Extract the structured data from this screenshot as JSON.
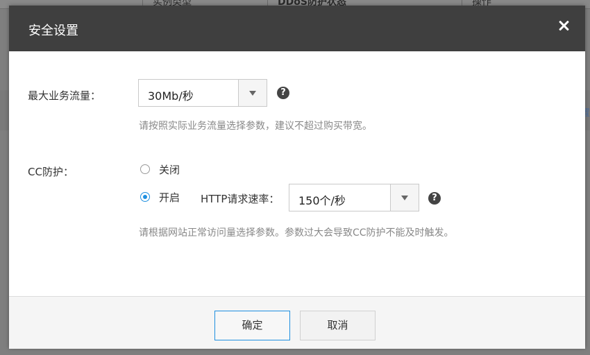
{
  "background": {
    "columns": [
      "实例类型",
      "DDoS防护状态",
      "操作"
    ],
    "edge_link": "置"
  },
  "dialog": {
    "title": "安全设置",
    "close_icon": "close-icon"
  },
  "max_traffic": {
    "label": "最大业务流量：",
    "selected": "30Mb/秒",
    "hint": "请按照实际业务流量选择参数，建议不超过购买带宽。",
    "help_icon": "question-circle-icon",
    "help_glyph": "?"
  },
  "cc_protection": {
    "label": "CC防护：",
    "options": [
      {
        "label": "关闭",
        "checked": false
      },
      {
        "label": "开启",
        "checked": true
      }
    ],
    "rate_label": "HTTP请求速率：",
    "rate_selected": "150个/秒",
    "help_icon": "question-circle-icon",
    "help_glyph": "?",
    "hint": "请根据网站正常访问量选择参数。参数过大会导致CC防护不能及时触发。"
  },
  "footer": {
    "ok_label": "确定",
    "cancel_label": "取消"
  },
  "colors": {
    "header_bg": "#3f3f3f",
    "accent": "#1d8fe0",
    "overlay": "#7f7f7f"
  }
}
